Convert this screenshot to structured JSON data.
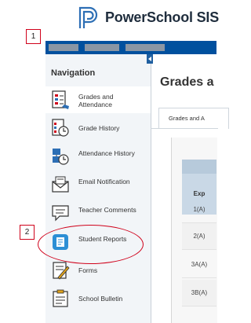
{
  "app": {
    "title": "PowerSchool SIS"
  },
  "colors": {
    "brand": "#00509e",
    "callout": "#d0021b"
  },
  "callouts": [
    "1",
    "2"
  ],
  "sidebar": {
    "title": "Navigation",
    "items": [
      {
        "label": "Grades and Attendance",
        "icon": "grades-attendance-icon",
        "active": true
      },
      {
        "label": "Grade History",
        "icon": "grade-history-icon"
      },
      {
        "label": "Attendance History",
        "icon": "attendance-history-icon"
      },
      {
        "label": "Email Notification",
        "icon": "email-notification-icon"
      },
      {
        "label": "Teacher Comments",
        "icon": "teacher-comments-icon"
      },
      {
        "label": "Student Reports",
        "icon": "student-reports-icon"
      },
      {
        "label": "Forms",
        "icon": "forms-icon"
      },
      {
        "label": "School Bulletin",
        "icon": "school-bulletin-icon"
      }
    ]
  },
  "main": {
    "title": "Grades a",
    "tab": "Grades and A",
    "table": {
      "header": "Exp",
      "rows": [
        "1(A)",
        "2(A)",
        "3A(A)",
        "3B(A)"
      ]
    }
  }
}
